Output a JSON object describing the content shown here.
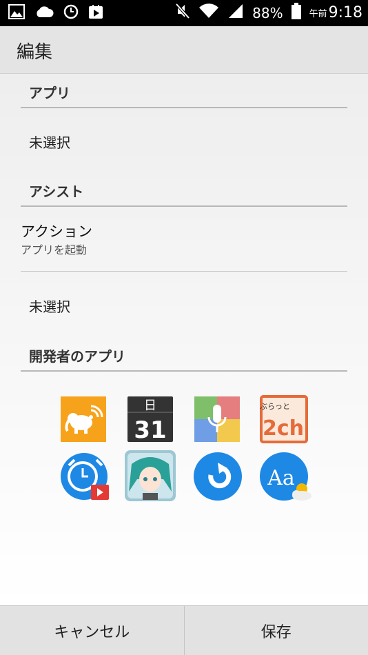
{
  "status_bar": {
    "battery": "88%",
    "ampm": "午前",
    "time": "9:18",
    "icons": [
      "image-icon",
      "cloud-icon",
      "clock-icon",
      "play-store-icon",
      "mute-icon",
      "wifi-icon",
      "signal-icon",
      "battery-icon"
    ]
  },
  "app_bar": {
    "title": "編集"
  },
  "sections": {
    "app": {
      "header": "アプリ",
      "value": "未選択"
    },
    "assist": {
      "header": "アシスト",
      "action_title": "アクション",
      "action_subtitle": "アプリを起動",
      "value": "未選択"
    },
    "developer": {
      "header": "開発者のアプリ",
      "calendar_day": "日",
      "calendar_date": "31",
      "board_label_top": "ぶらっと",
      "board_label_main": "2ch",
      "font_label": "Aa",
      "icons": [
        "elephant-app-icon",
        "calendar-app-icon",
        "voice-search-app-icon",
        "2ch-browser-app-icon",
        "alarm-video-app-icon",
        "character-app-icon",
        "refresh-app-icon",
        "font-weather-app-icon"
      ]
    }
  },
  "buttons": {
    "cancel": "キャンセル",
    "save": "保存"
  },
  "colors": {
    "status_bar": "#000000",
    "app_bar": "#e4e4e4",
    "accent_blue": "#1e88e5",
    "orange": "#f7a21b",
    "bottom_bar": "#e2e2e2"
  }
}
